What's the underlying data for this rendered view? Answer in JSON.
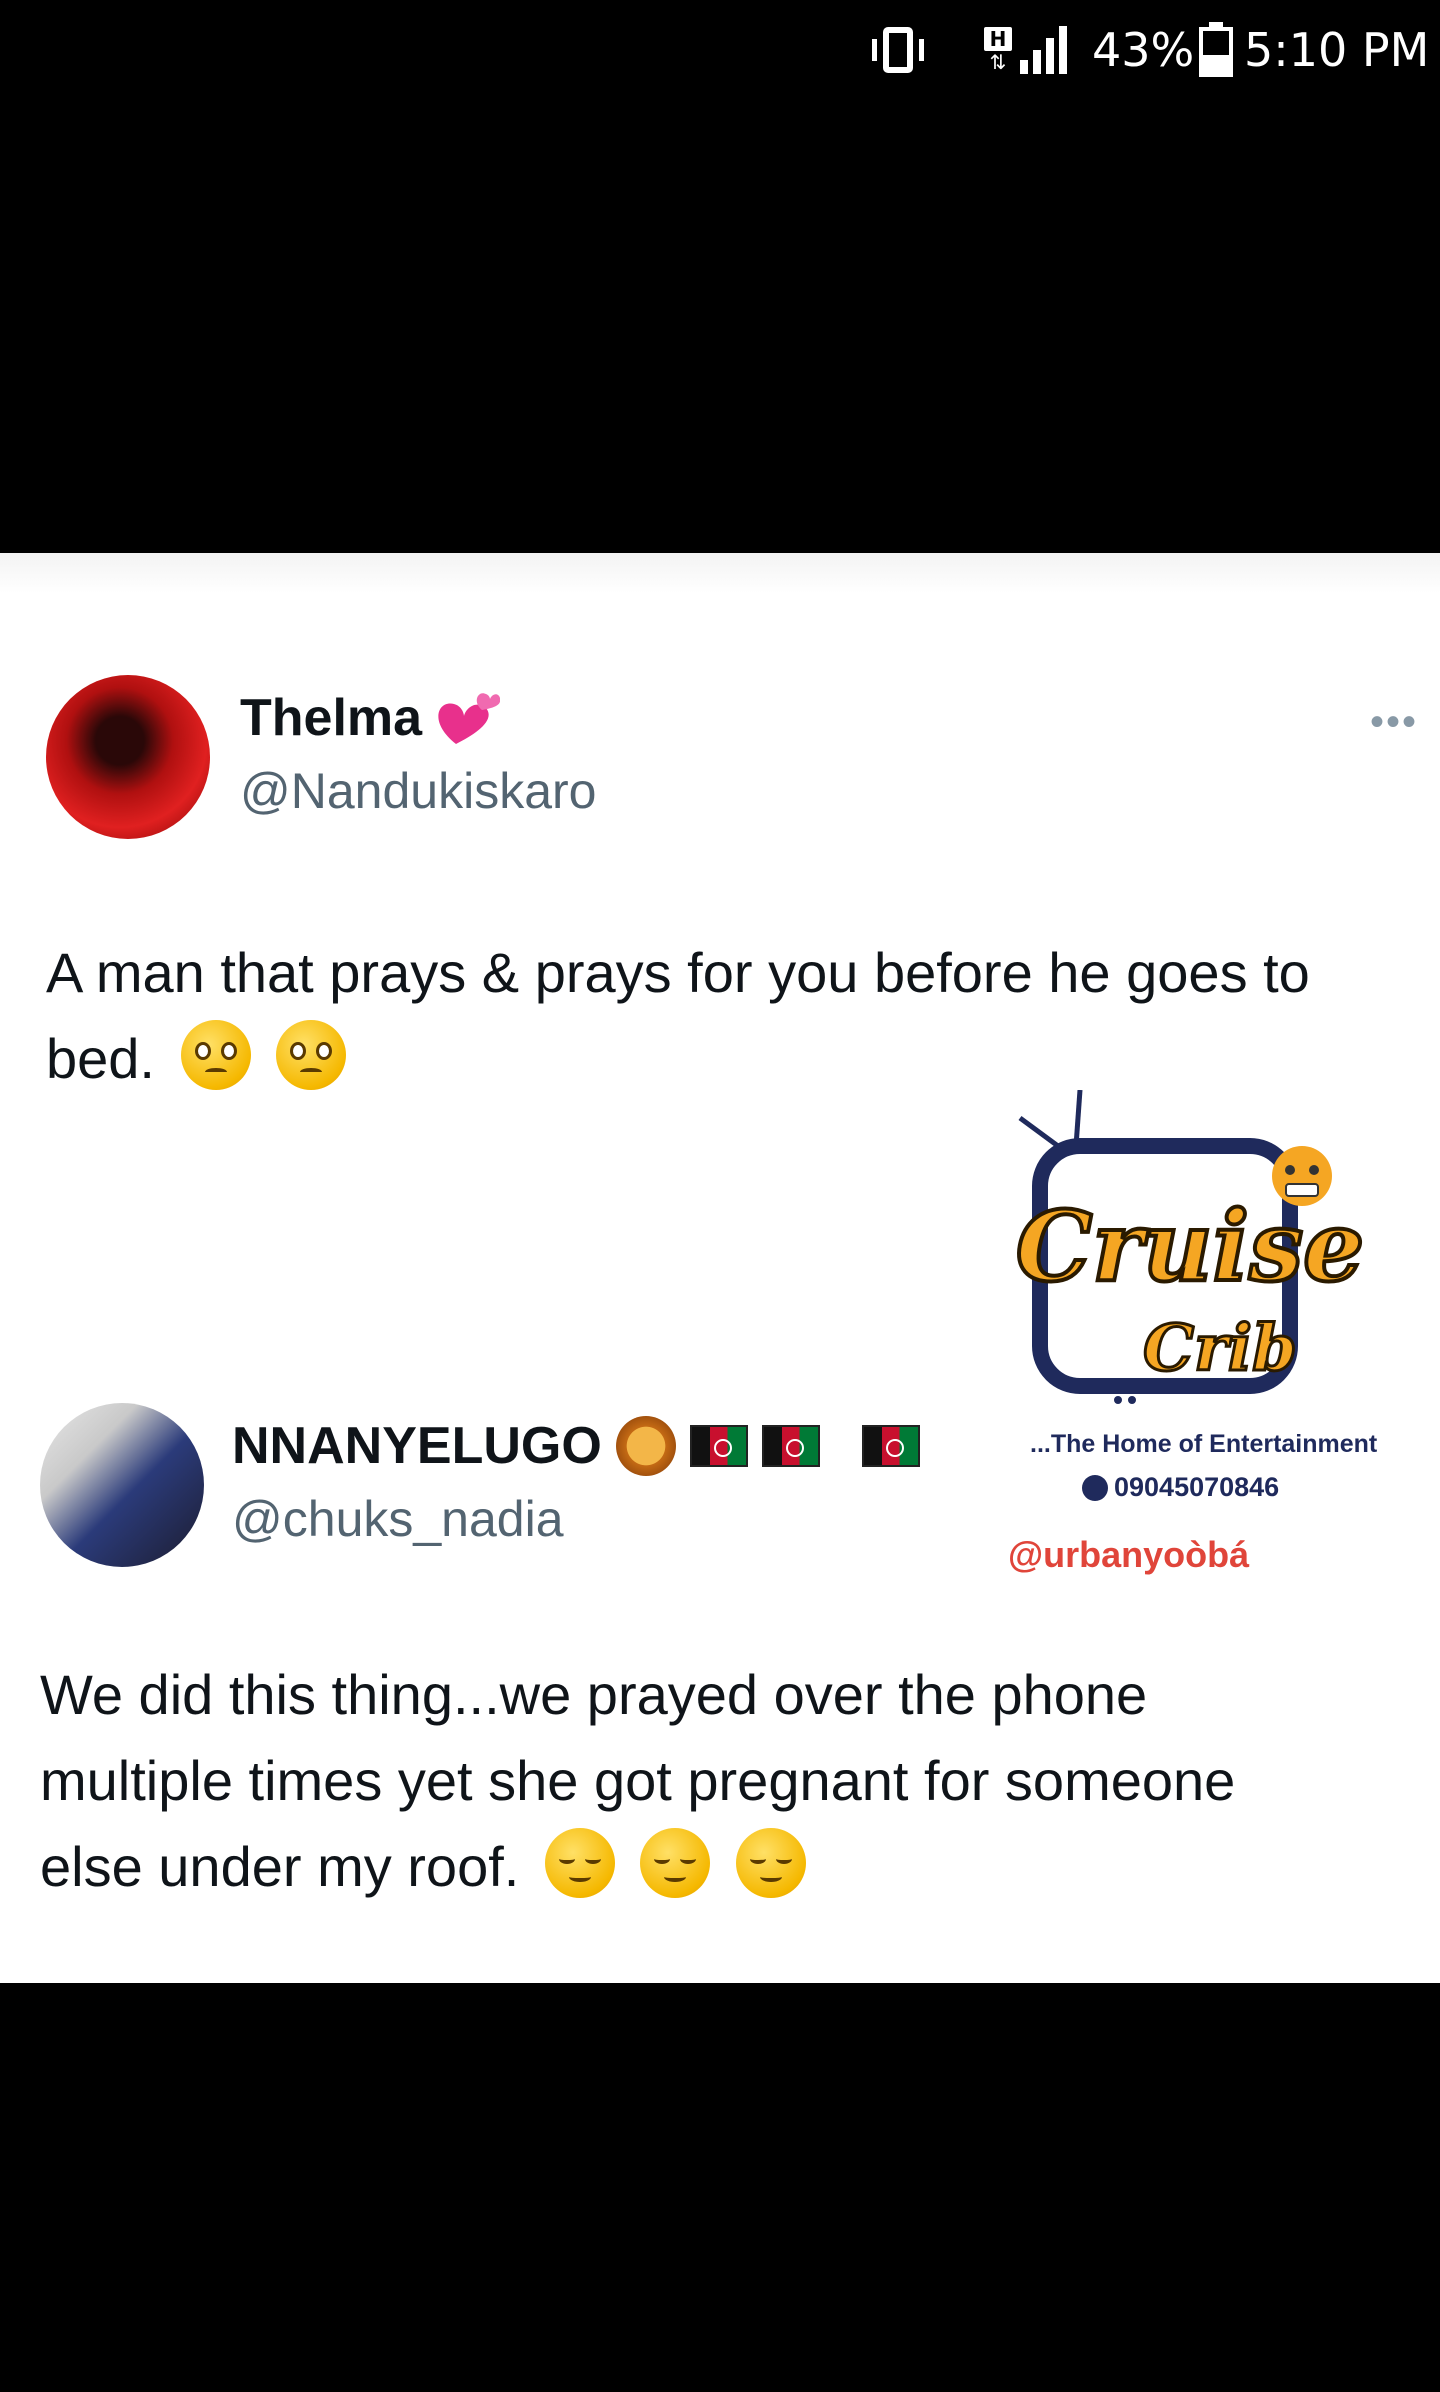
{
  "status_bar": {
    "network_label": "H",
    "battery_percent": "43%",
    "battery_level": 0.43,
    "time": "5:10 PM"
  },
  "tweets": [
    {
      "display_name": "Thelma",
      "name_emoji": "two-hearts",
      "handle": "@Nandukiskaro",
      "text": "A man that prays & prays for you before he goes to bed.",
      "trailing_emoji": [
        "pleading-face",
        "pleading-face"
      ],
      "more_label": "•••"
    },
    {
      "display_name": "NNANYELUGO",
      "name_emoji": [
        "lion-face",
        "afghanistan-flag",
        "afghanistan-flag",
        "afghanistan-flag"
      ],
      "handle": "@chuks_nadia",
      "text_lines": [
        "We did this thing...we prayed over the phone",
        "multiple times yet she got pregnant for someone",
        "else under my roof."
      ],
      "trailing_emoji": [
        "relieved-face",
        "relieved-face",
        "relieved-face"
      ]
    }
  ],
  "watermark": {
    "logo_line1": "Cruise",
    "logo_line2": "Crib",
    "tagline": "...The Home of Entertainment",
    "phone": "09045070846",
    "handle": "@urbanyoòbá",
    "colors": {
      "orange": "#f5a623",
      "navy": "#1f2a5c",
      "red": "#e0453a"
    }
  }
}
